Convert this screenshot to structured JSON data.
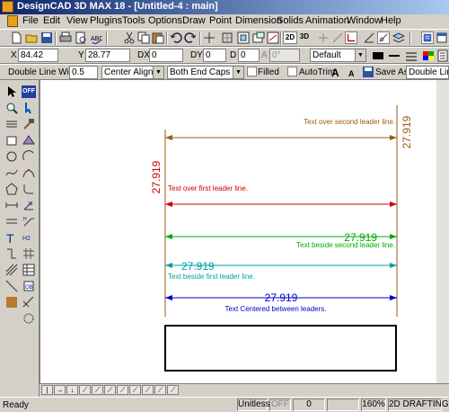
{
  "window": {
    "title": "DesignCAD 3D MAX 18 - [Untitled-4 : main]"
  },
  "menu": [
    "File",
    "Edit",
    "View",
    "Plugins",
    "Tools",
    "Options",
    "Draw",
    "Point",
    "Dimension",
    "Solids",
    "Animation",
    "Window",
    "Help"
  ],
  "view_buttons": {
    "two_d": "2D",
    "three_d": "3D"
  },
  "coords": {
    "x_label": "X",
    "x_value": "84.42",
    "y_label": "Y",
    "y_value": "28.77",
    "dx_label": "DX",
    "dx_value": "0",
    "dy_label": "DY",
    "dy_value": "0",
    "d_label": "D",
    "d_value": "0",
    "a_label": "A",
    "a_value": "0°",
    "layer_value": "Default"
  },
  "dim_toolbar": {
    "width_label": "Double Line Width:",
    "width_value": "0.5",
    "align_value": "Center Align",
    "caps_value": "Both End Caps",
    "filled_label": "Filled",
    "autotrim_label": "AutoTrim",
    "saveas_label": "Save As:",
    "saveas_value": "Double Line"
  },
  "left_tools": {
    "off_label": "OFF"
  },
  "drawing": {
    "dimension_value": "27.919",
    "labels": {
      "over_second": "Text over second leader line.",
      "over_first": "Text over first leader line.",
      "beside_second": "Text beside second leader line.",
      "beside_first": "Text beside first leader line.",
      "centered": "Text Centered between leaders."
    },
    "colors": {
      "brown": "#9a5a10",
      "red": "#cc0000",
      "green": "#00aa00",
      "cyan": "#00a0a0",
      "blue": "#0000cc"
    }
  },
  "status": {
    "ready": "Ready",
    "units": "Unitless",
    "off": "OFF",
    "zero": "0",
    "zoom": "160%",
    "mode": "2D DRAFTING"
  }
}
